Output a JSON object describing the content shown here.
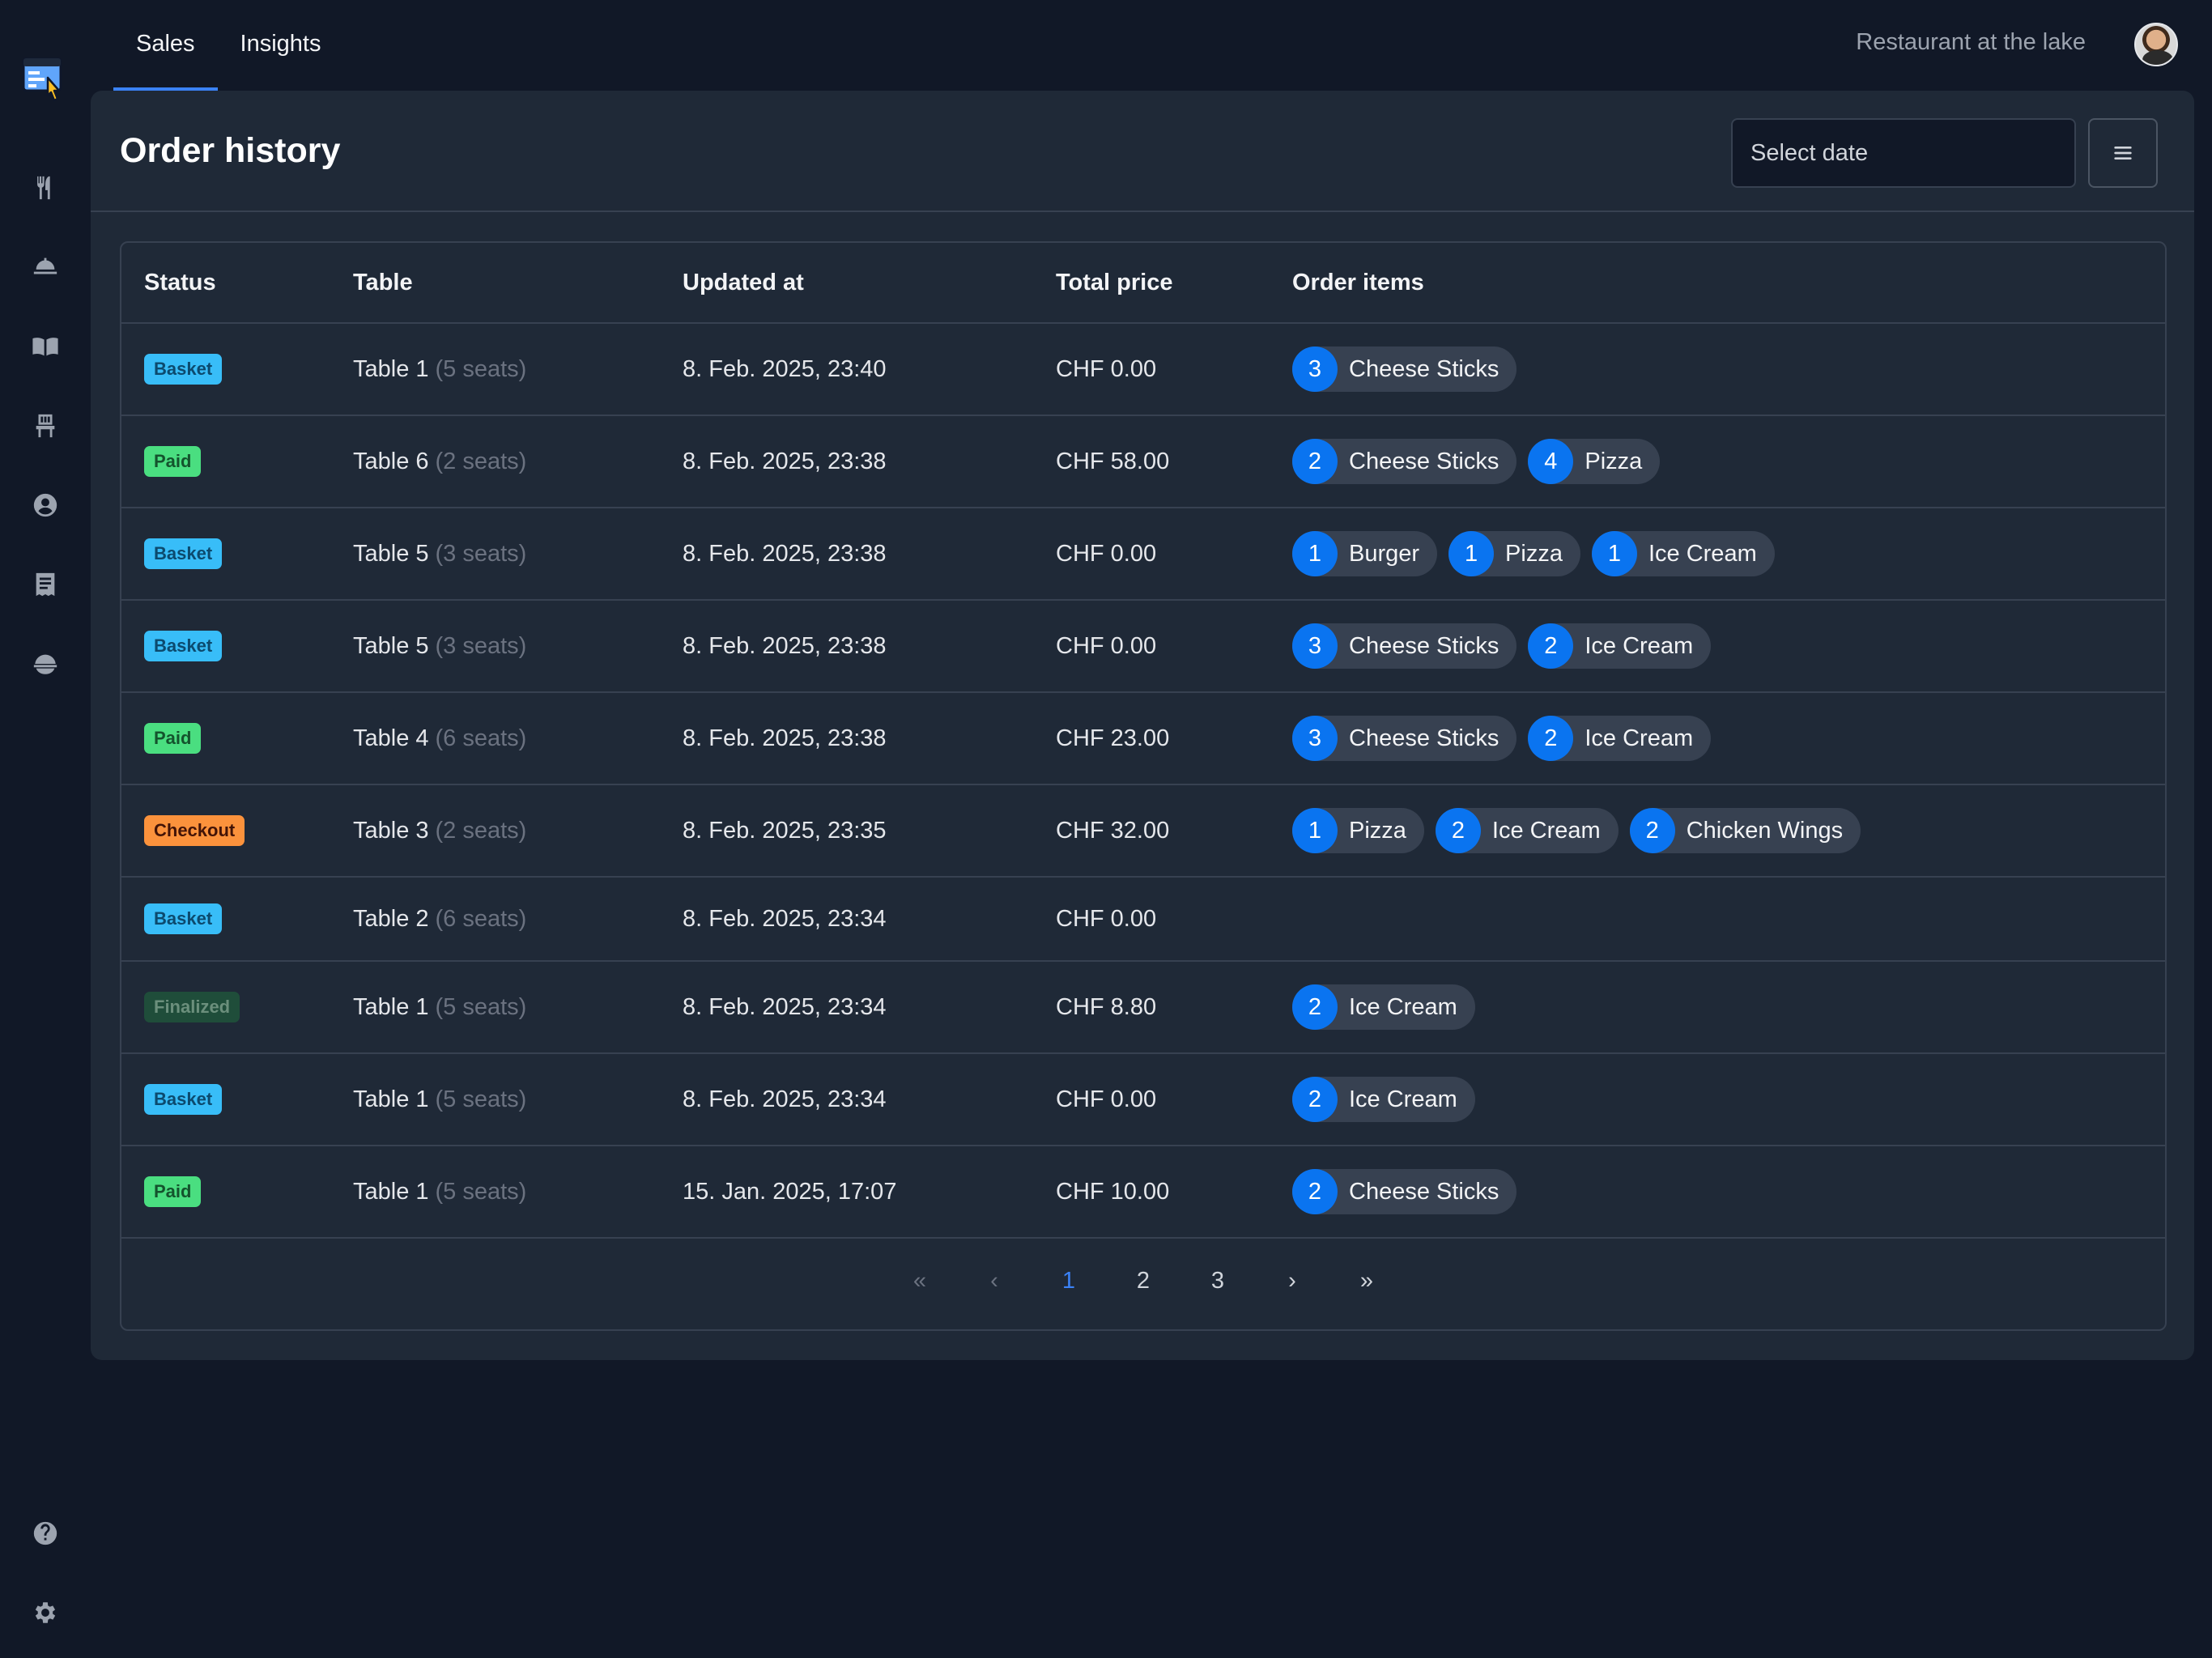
{
  "nav": {
    "tabs": [
      {
        "label": "Sales"
      },
      {
        "label": "Insights"
      }
    ],
    "restaurant_name": "Restaurant at the lake"
  },
  "sidebar": {
    "icons": [
      "cutlery-icon",
      "service-bell-icon",
      "menu-book-icon",
      "chair-icon",
      "user-circle-icon",
      "receipt-icon",
      "dish-cover-icon",
      "help-icon",
      "settings-icon"
    ]
  },
  "page": {
    "title": "Order history",
    "date_placeholder": "Select date"
  },
  "table": {
    "columns": {
      "status": "Status",
      "table": "Table",
      "updated": "Updated at",
      "price": "Total price",
      "items": "Order items"
    },
    "rows": [
      {
        "status": "Basket",
        "kind": "basket",
        "table": "Table 1",
        "seats": "(5 seats)",
        "updated": "8. Feb. 2025, 23:40",
        "price": "CHF 0.00",
        "items": [
          {
            "qty": "3",
            "name": "Cheese Sticks"
          }
        ]
      },
      {
        "status": "Paid",
        "kind": "paid",
        "table": "Table 6",
        "seats": "(2 seats)",
        "updated": "8. Feb. 2025, 23:38",
        "price": "CHF 58.00",
        "items": [
          {
            "qty": "2",
            "name": "Cheese Sticks"
          },
          {
            "qty": "4",
            "name": "Pizza"
          }
        ]
      },
      {
        "status": "Basket",
        "kind": "basket",
        "table": "Table 5",
        "seats": "(3 seats)",
        "updated": "8. Feb. 2025, 23:38",
        "price": "CHF 0.00",
        "items": [
          {
            "qty": "1",
            "name": "Burger"
          },
          {
            "qty": "1",
            "name": "Pizza"
          },
          {
            "qty": "1",
            "name": "Ice Cream"
          }
        ]
      },
      {
        "status": "Basket",
        "kind": "basket",
        "table": "Table 5",
        "seats": "(3 seats)",
        "updated": "8. Feb. 2025, 23:38",
        "price": "CHF 0.00",
        "items": [
          {
            "qty": "3",
            "name": "Cheese Sticks"
          },
          {
            "qty": "2",
            "name": "Ice Cream"
          }
        ]
      },
      {
        "status": "Paid",
        "kind": "paid",
        "table": "Table 4",
        "seats": "(6 seats)",
        "updated": "8. Feb. 2025, 23:38",
        "price": "CHF 23.00",
        "items": [
          {
            "qty": "3",
            "name": "Cheese Sticks"
          },
          {
            "qty": "2",
            "name": "Ice Cream"
          }
        ]
      },
      {
        "status": "Checkout",
        "kind": "checkout",
        "table": "Table 3",
        "seats": "(2 seats)",
        "updated": "8. Feb. 2025, 23:35",
        "price": "CHF 32.00",
        "items": [
          {
            "qty": "1",
            "name": "Pizza"
          },
          {
            "qty": "2",
            "name": "Ice Cream"
          },
          {
            "qty": "2",
            "name": "Chicken Wings"
          }
        ]
      },
      {
        "status": "Basket",
        "kind": "basket",
        "table": "Table 2",
        "seats": "(6 seats)",
        "updated": "8. Feb. 2025, 23:34",
        "price": "CHF 0.00",
        "items": []
      },
      {
        "status": "Finalized",
        "kind": "finalized",
        "table": "Table 1",
        "seats": "(5 seats)",
        "updated": "8. Feb. 2025, 23:34",
        "price": "CHF 8.80",
        "items": [
          {
            "qty": "2",
            "name": "Ice Cream"
          }
        ]
      },
      {
        "status": "Basket",
        "kind": "basket",
        "table": "Table 1",
        "seats": "(5 seats)",
        "updated": "8. Feb. 2025, 23:34",
        "price": "CHF 0.00",
        "items": [
          {
            "qty": "2",
            "name": "Ice Cream"
          }
        ]
      },
      {
        "status": "Paid",
        "kind": "paid",
        "table": "Table 1",
        "seats": "(5 seats)",
        "updated": "15. Jan. 2025, 17:07",
        "price": "CHF 10.00",
        "items": [
          {
            "qty": "2",
            "name": "Cheese Sticks"
          }
        ]
      }
    ]
  },
  "pagination": {
    "first": "«",
    "prev": "‹",
    "pages": [
      "1",
      "2",
      "3"
    ],
    "current": "1",
    "next": "›",
    "last": "»"
  },
  "colors": {
    "accent": "#3b82f6",
    "chip_qty": "#0a74f0",
    "basket": "#38bdf8",
    "paid": "#4ade80",
    "checkout": "#fb923c",
    "finalized": "#1f4d3a"
  }
}
